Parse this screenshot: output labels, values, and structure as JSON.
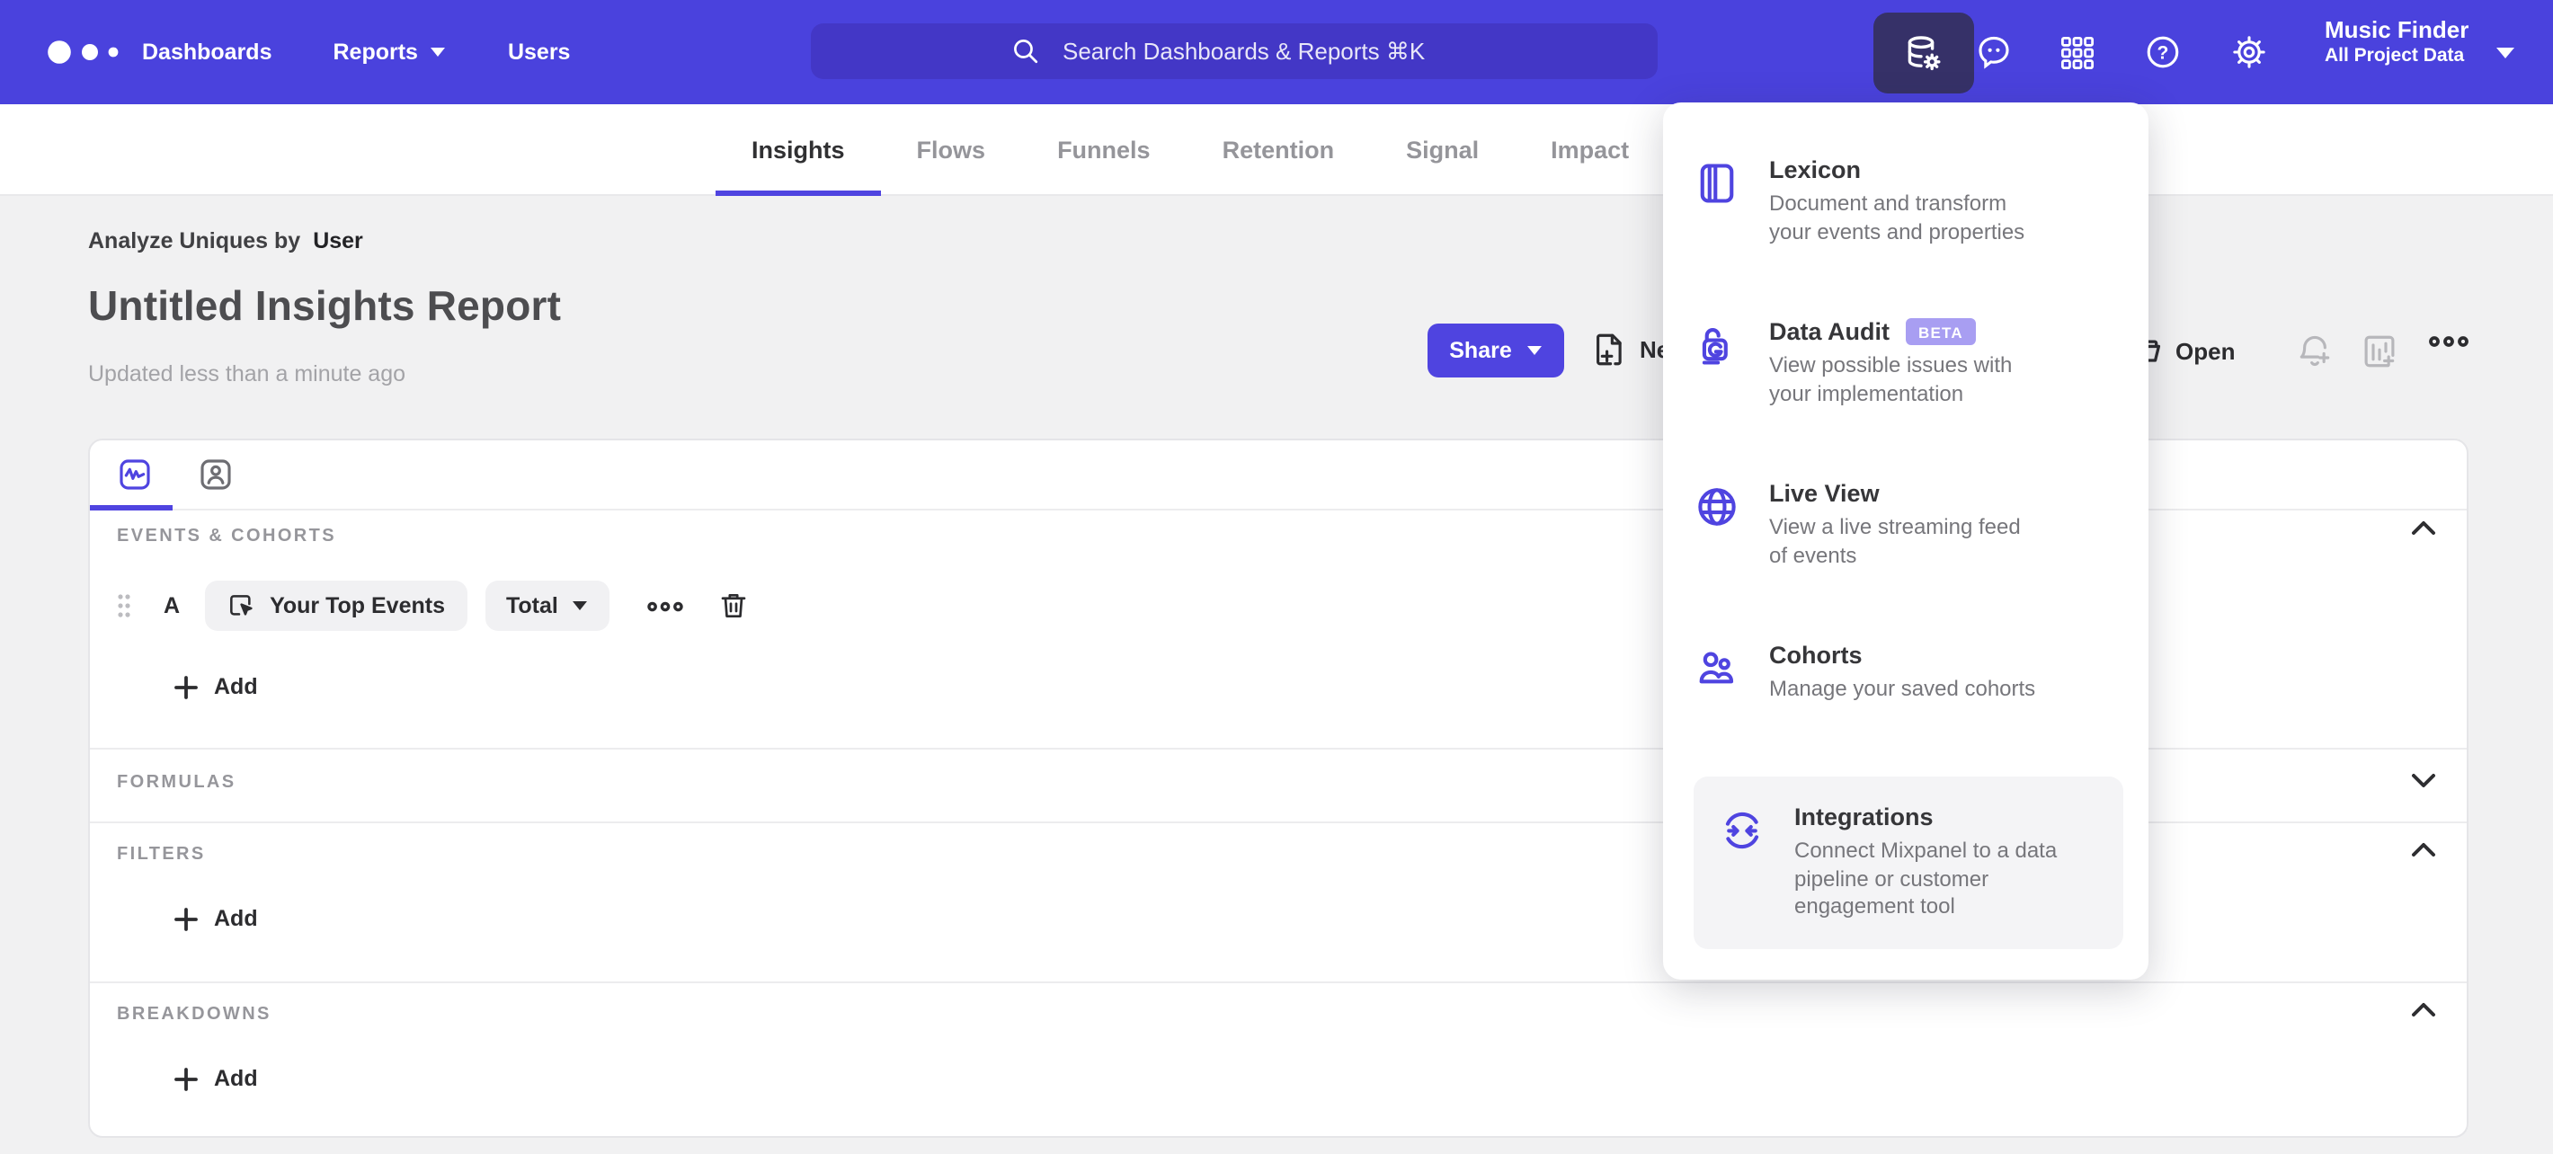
{
  "colors": {
    "accent": "#4f44e0",
    "topbar_bg": "#4a42dd",
    "search_bg": "#4337c6",
    "active_tile_bg": "#363168",
    "page_bg": "#f1f1f2",
    "beta_badge_bg": "#a89ef2"
  },
  "topbar": {
    "nav": [
      {
        "label": "Dashboards"
      },
      {
        "label": "Reports"
      },
      {
        "label": "Users"
      }
    ],
    "search": {
      "placeholder": "Search Dashboards & Reports ⌘K"
    },
    "icons": [
      "data-management",
      "feedback",
      "apps-grid",
      "help",
      "settings"
    ],
    "project": {
      "name": "Music Finder",
      "scope": "All Project Data"
    }
  },
  "tabs": [
    {
      "label": "Insights",
      "active": true
    },
    {
      "label": "Flows",
      "active": false
    },
    {
      "label": "Funnels",
      "active": false
    },
    {
      "label": "Retention",
      "active": false
    },
    {
      "label": "Signal",
      "active": false
    },
    {
      "label": "Impact",
      "active": false
    }
  ],
  "report": {
    "analyze_prefix": "Analyze Uniques by",
    "analyze_value": "User",
    "title": "Untitled Insights Report",
    "updated": "Updated less than a minute ago",
    "share_label": "Share",
    "new_label": "New",
    "open_label": "Open"
  },
  "builder": {
    "events": {
      "label": "EVENTS & COHORTS",
      "row": {
        "letter": "A",
        "event": "Your Top Events",
        "aggregation": "Total"
      },
      "add_label": "Add"
    },
    "formulas": {
      "label": "FORMULAS"
    },
    "filters": {
      "label": "FILTERS",
      "add_label": "Add"
    },
    "breakdowns": {
      "label": "BREAKDOWNS",
      "add_label": "Add"
    }
  },
  "menu": {
    "items": [
      {
        "title": "Lexicon",
        "desc": "Document and transform your events and properties",
        "icon": "lexicon-book-icon"
      },
      {
        "title": "Data Audit",
        "badge": "BETA",
        "desc": "View possible issues with your implementation",
        "icon": "data-audit-lock-icon"
      },
      {
        "title": "Live View",
        "desc": "View a live streaming feed of events",
        "icon": "live-view-globe-icon"
      },
      {
        "title": "Cohorts",
        "desc": "Manage your saved cohorts",
        "icon": "cohorts-people-icon"
      },
      {
        "title": "Integrations",
        "desc": "Connect Mixpanel to a data pipeline or customer engagement tool",
        "icon": "integrations-sync-icon"
      }
    ]
  }
}
